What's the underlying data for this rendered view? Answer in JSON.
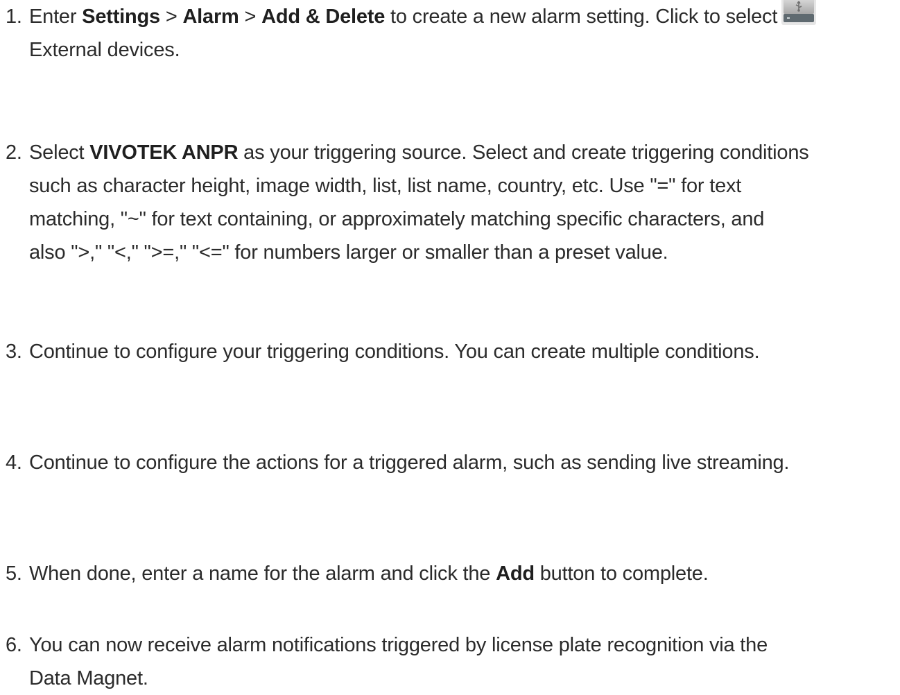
{
  "steps": [
    {
      "number": "1.",
      "parts": {
        "t1": "Enter ",
        "b1": "Settings",
        "t2": " > ",
        "b2": "Alarm",
        "t3": " > ",
        "b3": "Add & Delete",
        "t4": " to create a new alarm setting. Click to select",
        "t5": "External devices."
      },
      "icon": "usb-drive-icon"
    },
    {
      "number": "2.",
      "parts": {
        "t1": "Select ",
        "b1": "VIVOTEK ANPR",
        "t2": " as your triggering source. Select and create triggering conditions",
        "line2": "such as character height, image width, list, list name, country, etc. Use \"=\" for text",
        "line3": "matching, \"~\" for text containing, or approximately matching specific characters, and",
        "line4": "also \">,\" \"<,\" \">=,\" \"<=\" for numbers larger or smaller than a preset value."
      }
    },
    {
      "number": "3.",
      "text": "Continue to configure your triggering conditions. You can create multiple conditions."
    },
    {
      "number": "4.",
      "text": "Continue to configure the actions for a triggered alarm, such as sending live streaming."
    },
    {
      "number": "5.",
      "parts": {
        "t1": "When done, enter a name for the alarm and click the ",
        "b1": "Add",
        "t2": " button to complete."
      }
    },
    {
      "number": "6.",
      "parts": {
        "line1": "You can now receive alarm notifications triggered by license plate recognition via the",
        "line2": "Data Magnet."
      }
    }
  ]
}
